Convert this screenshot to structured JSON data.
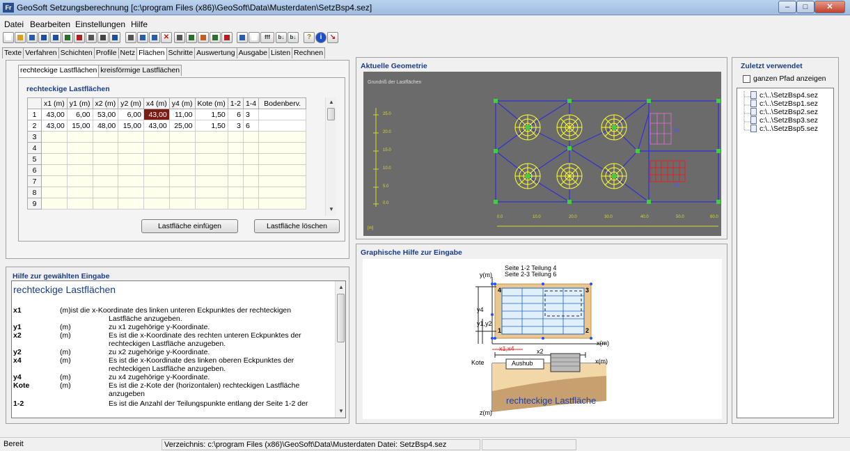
{
  "window": {
    "title": "GeoSoft Setzungsberechnung [c:\\program Files (x86)\\GeoSoft\\Data\\Musterdaten\\SetzBsp4.sez]",
    "app_icon": "Fr"
  },
  "menu": [
    "Datei",
    "Bearbeiten",
    "Einstellungen",
    "Hilfe"
  ],
  "toolbar": {
    "btn_fff": "fff",
    "btn_b1": "b↓",
    "btn_b2": "b↓",
    "btn_q": "?",
    "btn_i": "i"
  },
  "tabs": [
    "Texte",
    "Verfahren",
    "Schichten",
    "Profile",
    "Netz",
    "Flächen",
    "Schritte",
    "Auswertung",
    "Ausgabe",
    "Listen",
    "Rechnen"
  ],
  "subtabs": [
    "rechteckige Lastflächen",
    "kreisförmige Lastflächen"
  ],
  "table": {
    "title": "rechteckige Lastflächen",
    "headers": [
      "x1 (m)",
      "y1 (m)",
      "x2 (m)",
      "y2 (m)",
      "x4 (m)",
      "y4 (m)",
      "Kote (m)",
      "1-2",
      "1-4",
      "Bodenberv."
    ],
    "rows": [
      [
        "1",
        "43,00",
        "6,00",
        "53,00",
        "6,00",
        "43,00",
        "11,00",
        "1,50",
        "6",
        "3",
        ""
      ],
      [
        "2",
        "43,00",
        "15,00",
        "48,00",
        "15,00",
        "43,00",
        "25,00",
        "1,50",
        "3",
        "6",
        ""
      ],
      [
        "3",
        "",
        "",
        "",
        "",
        "",
        "",
        "",
        "",
        "",
        ""
      ],
      [
        "4",
        "",
        "",
        "",
        "",
        "",
        "",
        "",
        "",
        "",
        ""
      ],
      [
        "5",
        "",
        "",
        "",
        "",
        "",
        "",
        "",
        "",
        "",
        ""
      ],
      [
        "6",
        "",
        "",
        "",
        "",
        "",
        "",
        "",
        "",
        "",
        ""
      ],
      [
        "7",
        "",
        "",
        "",
        "",
        "",
        "",
        "",
        "",
        "",
        ""
      ],
      [
        "8",
        "",
        "",
        "",
        "",
        "",
        "",
        "",
        "",
        "",
        ""
      ],
      [
        "9",
        "",
        "",
        "",
        "",
        "",
        "",
        "",
        "",
        "",
        ""
      ]
    ],
    "insert_button": "Lastfläche einfügen",
    "delete_button": "Lastfläche löschen"
  },
  "help": {
    "panel_title": "Hilfe zur gewählten Eingabe",
    "heading": "rechteckige Lastflächen",
    "entries": [
      {
        "key": "x1",
        "unit": "(m)ist die x-Koordinate des linken unteren Eckpunktes der rechteckigen",
        "text": ""
      },
      {
        "key": "",
        "unit": "",
        "text": "Lastfläche anzugeben."
      },
      {
        "key": "y1",
        "unit": "(m)",
        "text": "zu x1 zugehörige y-Koordinate."
      },
      {
        "key": "x2",
        "unit": "(m)",
        "text": "Es ist die x-Koordinate des rechten unteren Eckpunktes der"
      },
      {
        "key": "",
        "unit": "",
        "text": "rechteckigen Lastfläche anzugeben."
      },
      {
        "key": "y2",
        "unit": "(m)",
        "text": "zu x2 zugehörige y-Koordinate."
      },
      {
        "key": "x4",
        "unit": "(m)",
        "text": "Es ist die x-Koordinate des linken oberen Eckpunktes der"
      },
      {
        "key": "",
        "unit": "",
        "text": "rechteckigen Lastfläche anzugeben."
      },
      {
        "key": "y4",
        "unit": "(m)",
        "text": "zu x4 zugehörige y-Koordinate."
      },
      {
        "key": "Kote",
        "unit": "(m)",
        "text": "Es ist die z-Kote der (horizontalen) rechteckigen Lastfläche"
      },
      {
        "key": "",
        "unit": "",
        "text": "anzugeben"
      },
      {
        "key": "1-2",
        "unit": "",
        "text": "Es ist die Anzahl der Teilungspunkte entlang der Seite 1-2 der"
      }
    ]
  },
  "geometry": {
    "panel_title": "Aktuelle Geometrie",
    "plot_title": "Grundriß der Lastflächen",
    "y_ticks": [
      "25.0",
      "20.0",
      "15.0",
      "10.0",
      "5.0",
      "0.0"
    ],
    "x_ticks": [
      "0.0",
      "10.0",
      "20.0",
      "30.0",
      "40.0",
      "50.0",
      "60.0"
    ],
    "unit": "[m]",
    "labels": [
      "20",
      "19"
    ]
  },
  "graphic_help": {
    "panel_title": "Graphische Hilfe zur Eingabe",
    "line1": "Seite 1-2  Teilung 4",
    "line2": "Seite 2-3  Teilung 6",
    "ym": "y(m)",
    "xm": "x(m)",
    "xm2": "x(m)",
    "zm": "z(m)",
    "y4": "y4",
    "y1y2": "y1,y2",
    "x1x4": "x1,x4",
    "x2": "x2",
    "kote": "Kote",
    "aushub": "Aushub",
    "caption": "rechteckige Lastfläche",
    "c1": "1",
    "c2": "2",
    "c3": "3",
    "c4": "4"
  },
  "recent": {
    "panel_title": "Zuletzt verwendet",
    "checkbox_label": "ganzen Pfad anzeigen",
    "files": [
      "c:\\..\\SetzBsp4.sez",
      "c:\\..\\SetzBsp1.sez",
      "c:\\..\\SetzBsp2.sez",
      "c:\\..\\SetzBsp3.sez",
      "c:\\..\\SetzBsp5.sez"
    ]
  },
  "status": {
    "left": "Bereit",
    "middle": "Verzeichnis: c:\\program Files (x86)\\GeoSoft\\Data\\Musterdaten   Datei: SetzBsp4.sez"
  },
  "colors": {
    "title_blue": "#1a3c88",
    "plot_bg": "#6b6b6b",
    "selected_cell": "#7a1c14",
    "plot_lines": "#2f2fd8",
    "load_circles": "#ffff33"
  }
}
